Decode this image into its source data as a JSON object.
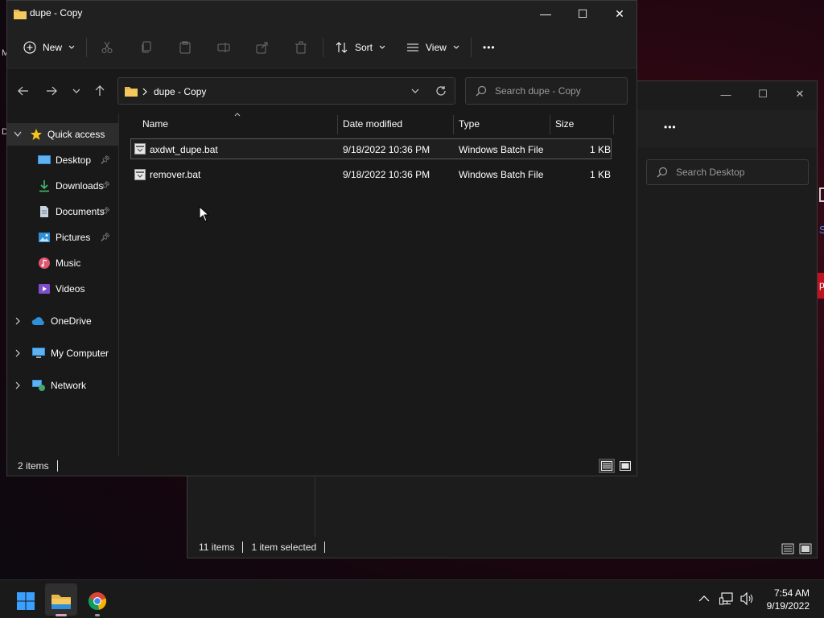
{
  "background_window": {
    "search_placeholder": "Search Desktop",
    "status_items": "11 items",
    "status_selected": "1 item selected",
    "more_label": "•••",
    "edge_letter_s": "S",
    "edge_letter_p": "p"
  },
  "window": {
    "title": "dupe - Copy",
    "minimize": "—",
    "maximize": "☐",
    "close": "✕"
  },
  "toolbar": {
    "new_label": "New",
    "sort_label": "Sort",
    "view_label": "View",
    "more_label": "•••"
  },
  "address": {
    "crumb": "dupe - Copy",
    "search_placeholder": "Search dupe - Copy"
  },
  "sidebar": {
    "quick_access": "Quick access",
    "items": [
      {
        "label": "Desktop",
        "pinned": true
      },
      {
        "label": "Downloads",
        "pinned": true
      },
      {
        "label": "Documents",
        "pinned": true
      },
      {
        "label": "Pictures",
        "pinned": true
      },
      {
        "label": "Music",
        "pinned": false
      },
      {
        "label": "Videos",
        "pinned": false
      }
    ],
    "onedrive": "OneDrive",
    "my_computer": "My Computer",
    "network": "Network"
  },
  "columns": {
    "name": "Name",
    "date": "Date modified",
    "type": "Type",
    "size": "Size"
  },
  "files": [
    {
      "name": "axdwt_dupe.bat",
      "date": "9/18/2022 10:36 PM",
      "type": "Windows Batch File",
      "size": "1 KB",
      "selected": true
    },
    {
      "name": "remover.bat",
      "date": "9/18/2022 10:36 PM",
      "type": "Windows Batch File",
      "size": "1 KB",
      "selected": false
    }
  ],
  "status": {
    "items": "2 items"
  },
  "taskbar": {
    "time": "7:54 AM",
    "date": "9/19/2022"
  },
  "desktop_edge": {
    "m": "M",
    "d": "D"
  },
  "colors": {
    "accent_blue": "#0078d4",
    "folder_yellow": "#e8b64c",
    "star_yellow": "#f5c518"
  }
}
